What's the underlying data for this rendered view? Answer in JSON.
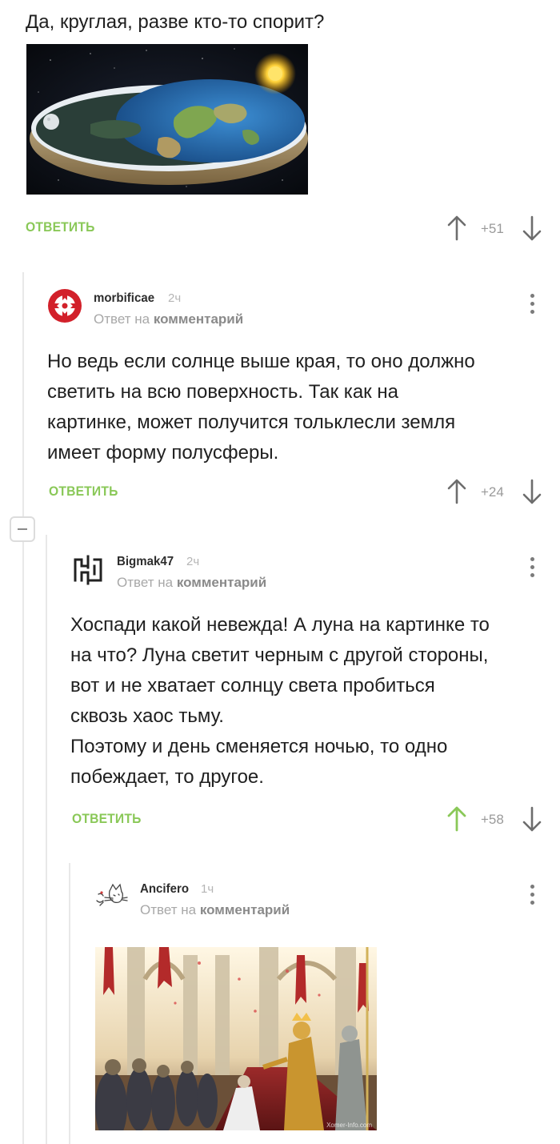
{
  "post": {
    "text": "Да, круглая, разве кто-то спорит?",
    "reply_label": "ОТВЕТИТЬ",
    "score": "+51"
  },
  "comments": [
    {
      "username": "morbificae",
      "time": "2ч",
      "reply_to_prefix": "Ответ на",
      "reply_to_target": "комментарий",
      "text": "Но ведь если солнце выше края, то оно должно\nсветить на всю поверхность. Так как на\nкартинке, может получится тольклеcли земля\nимеет форму полусферы.",
      "reply_label": "ОТВЕТИТЬ",
      "score": "+24"
    },
    {
      "username": "Bigmak47",
      "time": "2ч",
      "reply_to_prefix": "Ответ на",
      "reply_to_target": "комментарий",
      "text": "Хоспади какой невежда! А луна на картинке то\nна что? Луна светит черным с другой стороны,\nвот и не хватает солнцу света пробиться\nсквозь хаос тьму.\nПоэтому и день сменяется ночью, то одно\nпобеждает, то другое.",
      "reply_label": "ОТВЕТИТЬ",
      "score": "+58"
    },
    {
      "username": "Ancifero",
      "time": "1ч",
      "reply_to_prefix": "Ответ на",
      "reply_to_target": "комментарий"
    }
  ],
  "colors": {
    "accent_green": "#8ac858",
    "upvoted_green": "#8ac858",
    "muted_gray": "#9a9a9a"
  },
  "icons": [
    "upvote-arrow-icon",
    "downvote-arrow-icon",
    "kebab-menu-icon",
    "collapse-thread-icon"
  ],
  "image_watermark": "Xomer-Info.com"
}
